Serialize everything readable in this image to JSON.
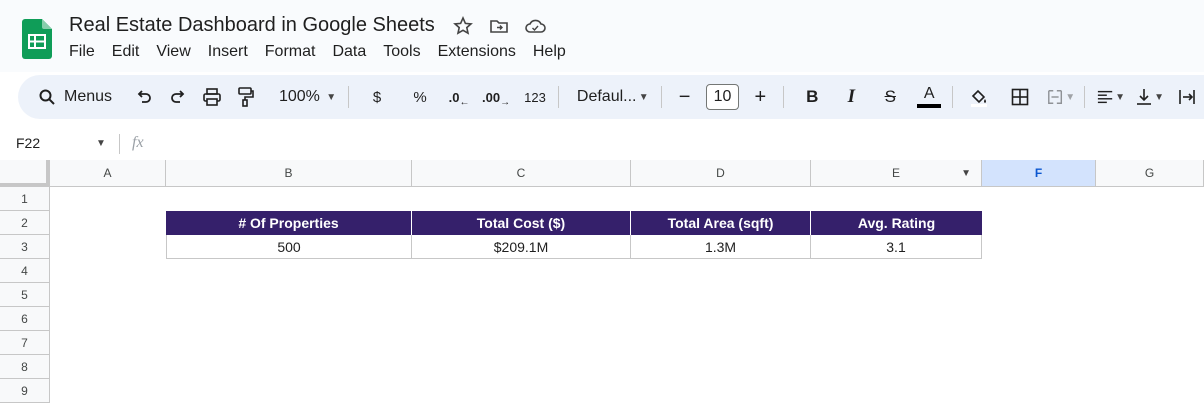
{
  "app": {
    "title": "Real Estate Dashboard in Google Sheets",
    "menu": [
      "File",
      "Edit",
      "View",
      "Insert",
      "Format",
      "Data",
      "Tools",
      "Extensions",
      "Help"
    ],
    "brand_color": "#0f9d58"
  },
  "toolbar": {
    "search_label": "Menus",
    "zoom": "100%",
    "currency": "$",
    "percent": "%",
    "dec_decrease": ".0",
    "dec_increase": ".00",
    "number_format": "123",
    "font": "Defaul...",
    "minus": "−",
    "font_size": "10",
    "plus": "+",
    "bold": "B",
    "italic": "I",
    "strike": "S",
    "text_color": "A"
  },
  "formula_bar": {
    "name_box": "F22",
    "fx": "fx"
  },
  "grid": {
    "columns": [
      "A",
      "B",
      "C",
      "D",
      "E",
      "F",
      "G"
    ],
    "selected_column": "F",
    "rows": [
      "1",
      "2",
      "3",
      "4",
      "5",
      "6",
      "7",
      "8",
      "9"
    ],
    "table": {
      "header_color": "#35206b",
      "headers": [
        "# Of Properties",
        "Total Cost ($)",
        "Total Area (sqft)",
        "Avg. Rating"
      ],
      "values": [
        "500",
        "$209.1M",
        "1.3M",
        "3.1"
      ]
    }
  }
}
